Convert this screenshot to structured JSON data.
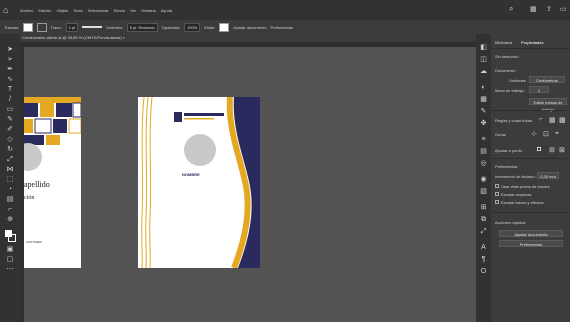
{
  "menubar": {
    "items": [
      "Archivo",
      "Edición",
      "Objeto",
      "Texto",
      "Seleccionar",
      "Efecto",
      "Ver",
      "Ventana",
      "Ayuda"
    ]
  },
  "controlbar": {
    "no_selection": "Trazado",
    "stroke_label": "Trazo:",
    "stroke_value": "1 pt",
    "brush_label": "Uniforme",
    "brush_style": "5 pt. Redondo",
    "opacity_label": "Opacidad:",
    "opacity_value": "100%",
    "style_label": "Estilo:",
    "doc_setup": "Ajustar documento",
    "prefs": "Preferencias"
  },
  "document": {
    "tab_title": "Credenciales afiche.ai @ 45,89 % (CMYK/Previsualizar) ×"
  },
  "artboard_left": {
    "name_text": "apellido",
    "sub_text": "ción",
    "footer_text": "CANTADEZ"
  },
  "artboard_right": {
    "logo_text": "INSTITUCIÓN EDUCATIVA",
    "name_text": "NOMBRE"
  },
  "panel": {
    "tabs": [
      "Biblioteca",
      "Propiedades"
    ],
    "no_selection": "Sin selección",
    "doc_label": "Documento",
    "units_label": "Unidades",
    "units_value": "Centímetros",
    "artboard_label": "Mesa de trabajo:",
    "artboard_value": "1",
    "edit_artboards": "Editar mesas de trabajo",
    "rulers_label": "Reglas y cuadrículas",
    "guides_label": "Guías",
    "snap_label": "Ajustar a punto",
    "prefs_label": "Preferencias",
    "keyboard_inc_label": "Incremento de teclado:",
    "keyboard_inc_value": "0,35 mm",
    "corner_label": "Usar vista previa de bordes",
    "scale_corners": "Escalar esquinas",
    "scale_strokes": "Escalar trazos y efectos",
    "quick_actions": "Acciones rápidas",
    "btn_doc_setup": "Ajustar documento",
    "btn_prefs": "Preferencias"
  },
  "colors": {
    "navy": "#2a2a5e",
    "gold": "#e4a823",
    "gray_circle": "#c9c9c9"
  }
}
